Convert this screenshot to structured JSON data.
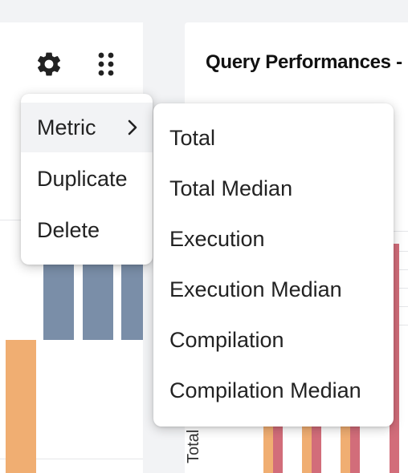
{
  "left_panel": {
    "settings_icon": "gear-icon",
    "drag_icon": "drag-handle-icon"
  },
  "right_panel": {
    "title": "Query Performances -",
    "y_axis_label": "Total"
  },
  "context_menu": {
    "items": [
      {
        "label": "Metric",
        "has_submenu": true,
        "active": true
      },
      {
        "label": "Duplicate"
      },
      {
        "label": "Delete"
      }
    ]
  },
  "metric_submenu": {
    "items": [
      {
        "label": "Total"
      },
      {
        "label": "Total Median"
      },
      {
        "label": "Execution"
      },
      {
        "label": "Execution Median"
      },
      {
        "label": "Compilation"
      },
      {
        "label": "Compilation Median"
      }
    ]
  },
  "colors": {
    "bar_blue": "#7a8ea8",
    "bar_orange": "#f0ae72",
    "bar_red": "#d26d7a",
    "menu_active_bg": "#f2f3f5"
  }
}
